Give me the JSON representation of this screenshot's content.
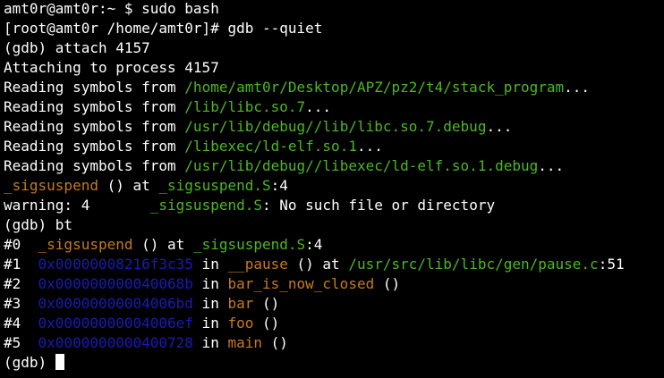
{
  "colors": {
    "background": "#000000",
    "text": "#ffffff",
    "path_green": "#4cb820",
    "function_orange": "#c87a1c",
    "address_blue": "#1a1ab8"
  },
  "terminal": {
    "lines": [
      {
        "id": "shell-prompt-line",
        "segments": [
          {
            "text": "amt0r@amt0r:~ $ sudo bash",
            "color": "white"
          }
        ]
      },
      {
        "id": "root-prompt-line",
        "segments": [
          {
            "text": "[root@amt0r /home/amt0r]# gdb --quiet",
            "color": "white"
          }
        ]
      },
      {
        "id": "gdb-attach-line",
        "segments": [
          {
            "text": "(gdb) attach 4157",
            "color": "white"
          }
        ]
      },
      {
        "id": "attaching-line",
        "segments": [
          {
            "text": "Attaching to process 4157",
            "color": "white"
          }
        ]
      },
      {
        "id": "reading-symbols-line",
        "segments": [
          {
            "text": "Reading symbols from ",
            "color": "white"
          },
          {
            "text": "/home/amt0r/Desktop/APZ/pz2/t4/stack_program",
            "color": "green"
          },
          {
            "text": "...",
            "color": "white"
          }
        ]
      },
      {
        "id": "reading-symbols-line",
        "segments": [
          {
            "text": "Reading symbols from ",
            "color": "white"
          },
          {
            "text": "/lib/libc.so.7",
            "color": "green"
          },
          {
            "text": "...",
            "color": "white"
          }
        ]
      },
      {
        "id": "reading-symbols-line",
        "segments": [
          {
            "text": "Reading symbols from ",
            "color": "white"
          },
          {
            "text": "/usr/lib/debug//lib/libc.so.7.debug",
            "color": "green"
          },
          {
            "text": "...",
            "color": "white"
          }
        ]
      },
      {
        "id": "reading-symbols-line",
        "segments": [
          {
            "text": "Reading symbols from ",
            "color": "white"
          },
          {
            "text": "/libexec/ld-elf.so.1",
            "color": "green"
          },
          {
            "text": "...",
            "color": "white"
          }
        ]
      },
      {
        "id": "reading-symbols-line",
        "segments": [
          {
            "text": "Reading symbols from ",
            "color": "white"
          },
          {
            "text": "/usr/lib/debug//libexec/ld-elf.so.1.debug",
            "color": "green"
          },
          {
            "text": "...",
            "color": "white"
          }
        ]
      },
      {
        "id": "stop-location-line",
        "segments": [
          {
            "text": "_sigsuspend",
            "color": "orange"
          },
          {
            "text": " () at ",
            "color": "white"
          },
          {
            "text": "_sigsuspend.S",
            "color": "green"
          },
          {
            "text": ":4",
            "color": "white"
          }
        ]
      },
      {
        "id": "warning-line",
        "segments": [
          {
            "text": "warning: 4       ",
            "color": "white"
          },
          {
            "text": "_sigsuspend.S",
            "color": "green"
          },
          {
            "text": ": No such file or directory",
            "color": "white"
          }
        ]
      },
      {
        "id": "gdb-bt-line",
        "segments": [
          {
            "text": "(gdb) bt",
            "color": "white"
          }
        ]
      },
      {
        "id": "backtrace-frame",
        "segments": [
          {
            "text": "#0  ",
            "color": "white"
          },
          {
            "text": "_sigsuspend",
            "color": "orange"
          },
          {
            "text": " () at ",
            "color": "white"
          },
          {
            "text": "_sigsuspend.S",
            "color": "green"
          },
          {
            "text": ":4",
            "color": "white"
          }
        ]
      },
      {
        "id": "backtrace-frame",
        "segments": [
          {
            "text": "#1  ",
            "color": "white"
          },
          {
            "text": "0x00000008216f3c35",
            "color": "blue"
          },
          {
            "text": " in ",
            "color": "white"
          },
          {
            "text": "__pause",
            "color": "orange"
          },
          {
            "text": " () at ",
            "color": "white"
          },
          {
            "text": "/usr/src/lib/libc/gen/pause.c",
            "color": "green"
          },
          {
            "text": ":51",
            "color": "white"
          }
        ]
      },
      {
        "id": "backtrace-frame",
        "segments": [
          {
            "text": "#2  ",
            "color": "white"
          },
          {
            "text": "0x000000000040068b",
            "color": "blue"
          },
          {
            "text": " in ",
            "color": "white"
          },
          {
            "text": "bar_is_now_closed",
            "color": "orange"
          },
          {
            "text": " ()",
            "color": "white"
          }
        ]
      },
      {
        "id": "backtrace-frame",
        "segments": [
          {
            "text": "#3  ",
            "color": "white"
          },
          {
            "text": "0x00000000004006bd",
            "color": "blue"
          },
          {
            "text": " in ",
            "color": "white"
          },
          {
            "text": "bar",
            "color": "orange"
          },
          {
            "text": " ()",
            "color": "white"
          }
        ]
      },
      {
        "id": "backtrace-frame",
        "segments": [
          {
            "text": "#4  ",
            "color": "white"
          },
          {
            "text": "0x00000000004006ef",
            "color": "blue"
          },
          {
            "text": " in ",
            "color": "white"
          },
          {
            "text": "foo",
            "color": "orange"
          },
          {
            "text": " ()",
            "color": "white"
          }
        ]
      },
      {
        "id": "backtrace-frame",
        "segments": [
          {
            "text": "#5  ",
            "color": "white"
          },
          {
            "text": "0x0000000000400728",
            "color": "blue"
          },
          {
            "text": " in ",
            "color": "white"
          },
          {
            "text": "main",
            "color": "orange"
          },
          {
            "text": " ()",
            "color": "white"
          }
        ]
      },
      {
        "id": "gdb-input-line",
        "cursor": true,
        "segments": [
          {
            "text": "(gdb) ",
            "color": "white"
          }
        ]
      }
    ]
  }
}
